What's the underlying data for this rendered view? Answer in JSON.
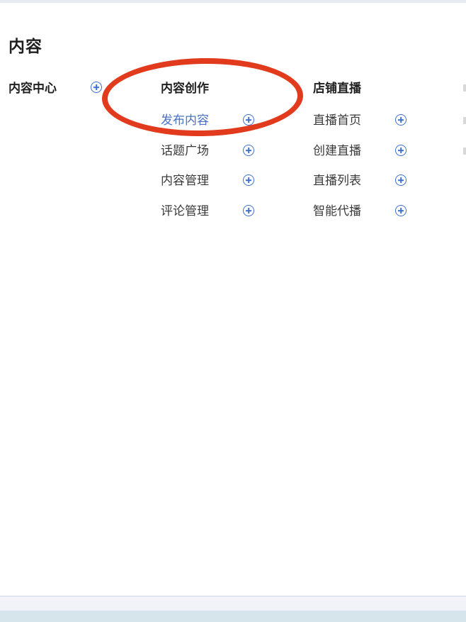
{
  "page": {
    "title": "内容"
  },
  "columns": [
    {
      "title": "内容中心",
      "items": []
    },
    {
      "title": "内容创作",
      "items": [
        {
          "label": "发布内容",
          "active": true
        },
        {
          "label": "话题广场"
        },
        {
          "label": "内容管理"
        },
        {
          "label": "评论管理"
        }
      ]
    },
    {
      "title": "店铺直播",
      "items": [
        {
          "label": "直播首页"
        },
        {
          "label": "创建直播"
        },
        {
          "label": "直播列表"
        },
        {
          "label": "智能代播"
        }
      ]
    }
  ],
  "icons": {
    "add": "plus-circle-icon"
  },
  "colors": {
    "accent": "#3e6fcf",
    "active_text": "#4a72c4",
    "annotation": "#e13a1d"
  }
}
